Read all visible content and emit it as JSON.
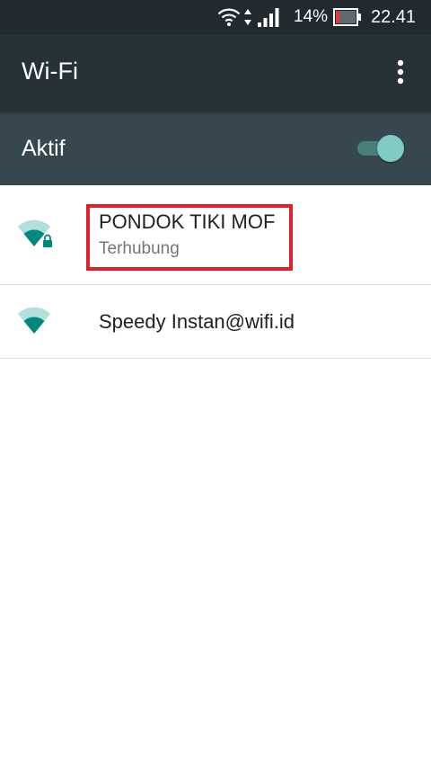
{
  "status_bar": {
    "battery_percent": "14%",
    "time": "22.41",
    "icons": [
      "wifi-icon",
      "data-activity-icon",
      "cell-signal-icon",
      "battery-low-icon"
    ],
    "battery_level": 0.14
  },
  "toolbar": {
    "title": "Wi-Fi",
    "overflow_icon": "more-vert-icon"
  },
  "master_switch": {
    "label": "Aktif",
    "checked": true
  },
  "networks": [
    {
      "ssid": "PONDOK TIKI MOF",
      "summary": "Terhubung",
      "secured": true,
      "highlighted": true,
      "icon": "wifi-signal-locked-icon"
    },
    {
      "ssid": "Speedy Instan@wifi.id",
      "summary": "",
      "secured": false,
      "highlighted": false,
      "icon": "wifi-signal-icon"
    }
  ],
  "colors": {
    "status_bar": "#212a2f",
    "toolbar": "#263238",
    "switch_bar": "#37474f",
    "accent": "#009688",
    "highlight": "#e0202e"
  }
}
